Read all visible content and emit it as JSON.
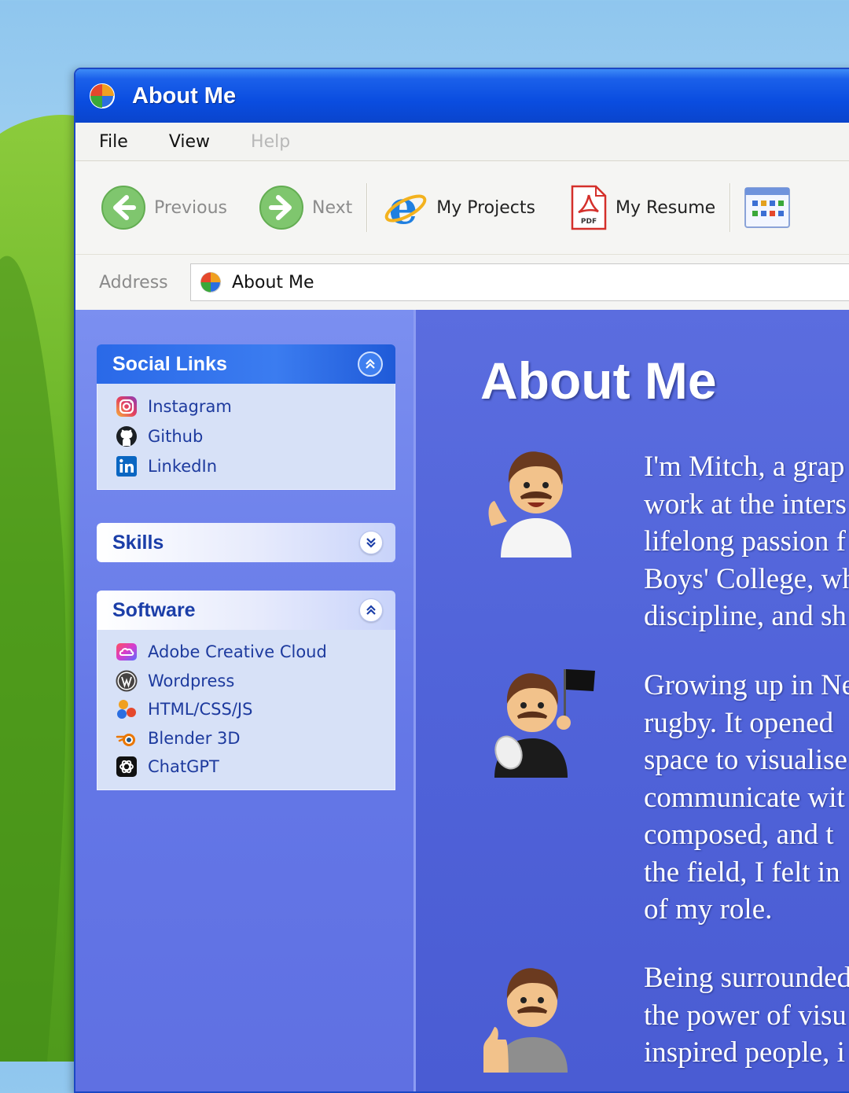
{
  "window": {
    "title": "About Me"
  },
  "menu": {
    "file": "File",
    "view": "View",
    "help": "Help"
  },
  "toolbar": {
    "previous": "Previous",
    "next": "Next",
    "projects": "My Projects",
    "resume": "My Resume",
    "pdf_badge": "PDF"
  },
  "address": {
    "label": "Address",
    "value": "About Me"
  },
  "sidebar": {
    "social": {
      "title": "Social Links",
      "items": [
        {
          "label": "Instagram",
          "icon": "instagram-icon"
        },
        {
          "label": "Github",
          "icon": "github-icon"
        },
        {
          "label": "LinkedIn",
          "icon": "linkedin-icon"
        }
      ]
    },
    "skills": {
      "title": "Skills"
    },
    "software": {
      "title": "Software",
      "items": [
        {
          "label": "Adobe Creative Cloud",
          "icon": "adobe-creative-cloud-icon"
        },
        {
          "label": "Wordpress",
          "icon": "wordpress-icon"
        },
        {
          "label": "HTML/CSS/JS",
          "icon": "html-css-js-icon"
        },
        {
          "label": "Blender 3D",
          "icon": "blender-icon"
        },
        {
          "label": "ChatGPT",
          "icon": "chatgpt-icon"
        }
      ]
    }
  },
  "main": {
    "heading": "About Me",
    "paragraphs": [
      "I'm Mitch, a grap\nwork at the inters\nlifelong passion f\nBoys' College, wh\ndiscipline, and sh",
      "Growing up in Ne\nrugby. It opened\nspace to visualise\ncommunicate wit\ncomposed, and t\nthe field, I felt in\nof my role.",
      "Being surrounded\nthe power of visu\ninspired people, i"
    ]
  },
  "colors": {
    "titlebar": "#0a4de0",
    "sidebar": "#6f82ec",
    "main": "#5063d9",
    "panel_body": "#d7e1f7",
    "link_text": "#1d3a9e"
  }
}
